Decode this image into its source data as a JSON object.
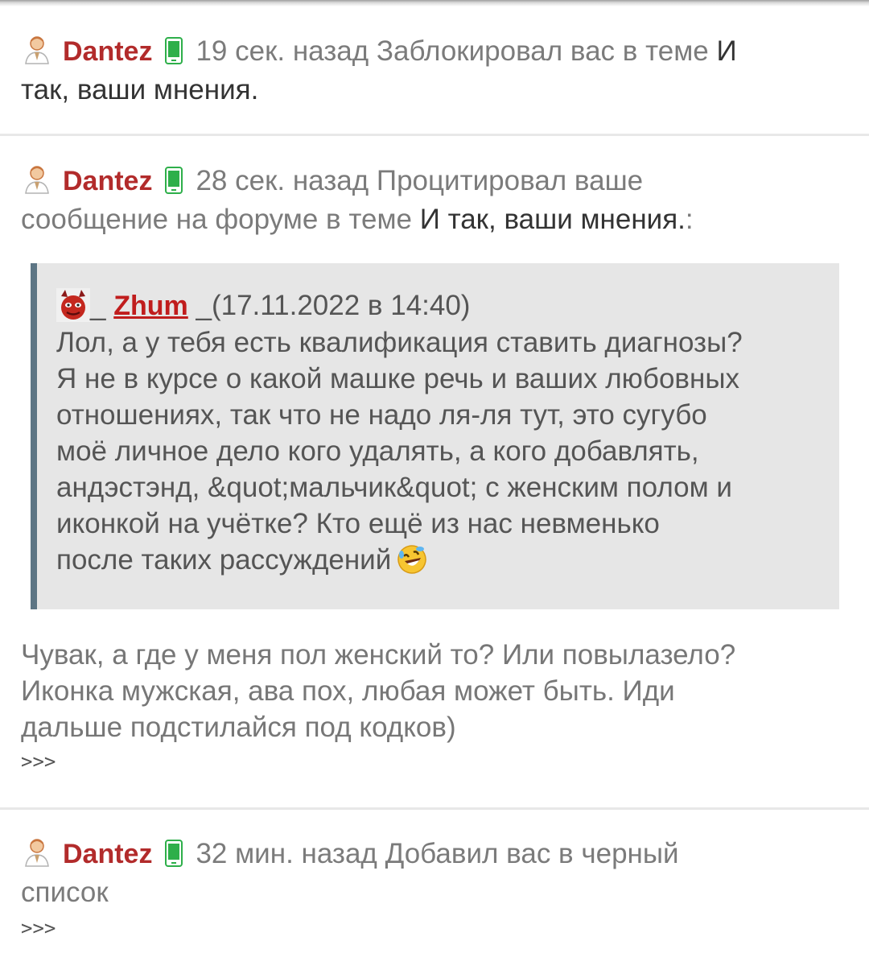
{
  "notifications": [
    {
      "user": "Dantez",
      "time": "19 сек. назад",
      "action": "Заблокировал вас в теме",
      "topic_line1": "И",
      "topic_line2": "так, ваши мнения."
    },
    {
      "user": "Dantez",
      "time": "28 сек. назад",
      "action_line1": "Процитировал ваше",
      "action_line2": "сообщение на форуме в теме",
      "topic": "И так, ваши мнения.",
      "topic_suffix": ":",
      "quote": {
        "author": "Zhum",
        "date": "(17.11.2022 в 14:40)",
        "lines": [
          "Лол, а у тебя есть квалификация ставить диагнозы?",
          "Я не в курсе о какой машке речь и ваших любовных",
          "отношениях, так что не надо ля-ля тут, это сугубо",
          "моё личное дело кого удалять, а кого добавлять,",
          "андэстэнд, &quot;мальчик&quot; с женским полом и",
          "иконкой на учётке? Кто ещё из нас невменько",
          "после таких рассуждений"
        ],
        "emoji": "rolling-on-floor-laughing"
      },
      "reply_lines": [
        "Чувак, а где у меня пол женский то? Или повылазело?",
        "Иконка мужская, ава пох, любая может быть. Иди",
        "дальше подстилайся под кодков)"
      ],
      "more": ">>>"
    },
    {
      "user": "Dantez",
      "time": "32 мин. назад",
      "action_line1": "Добавил вас в черный",
      "action_line2": "список",
      "more": ">>>"
    }
  ],
  "colors": {
    "username": "#b22b2b",
    "quote_user": "#c01d1d",
    "quote_bg": "#e6e6e6",
    "quote_border": "#5d7584",
    "phone_green": "#2eaf4a"
  },
  "icons": [
    "user-icon",
    "phone-icon",
    "devil-avatar",
    "laughing-emoji"
  ]
}
